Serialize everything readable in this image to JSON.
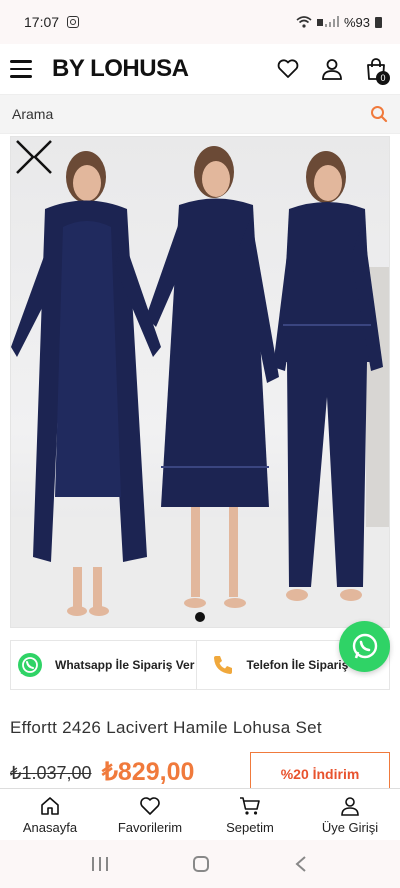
{
  "status_bar": {
    "time": "17:07",
    "battery": "%93"
  },
  "header": {
    "logo": "BY LOHUSA",
    "cart_count": "0"
  },
  "search": {
    "placeholder": "Arama"
  },
  "contact": {
    "whatsapp_label": "Whatsapp İle Sipariş Ver",
    "phone_label": "Telefon İle Sipariş"
  },
  "product": {
    "title": "Effortt 2426 Lacivert Hamile Lohusa Set",
    "old_price": "₺1.037,00",
    "new_price": "₺829,00",
    "discount": "%20 İndirim"
  },
  "bottom_nav": {
    "items": [
      {
        "label": "Anasayfa",
        "icon": "home-icon"
      },
      {
        "label": "Favorilerim",
        "icon": "heart-icon"
      },
      {
        "label": "Sepetim",
        "icon": "cart-icon"
      },
      {
        "label": "Üye Girişi",
        "icon": "user-icon"
      }
    ]
  },
  "colors": {
    "accent": "#f07a3c",
    "whatsapp": "#2fd366",
    "garment": "#1c2452"
  }
}
